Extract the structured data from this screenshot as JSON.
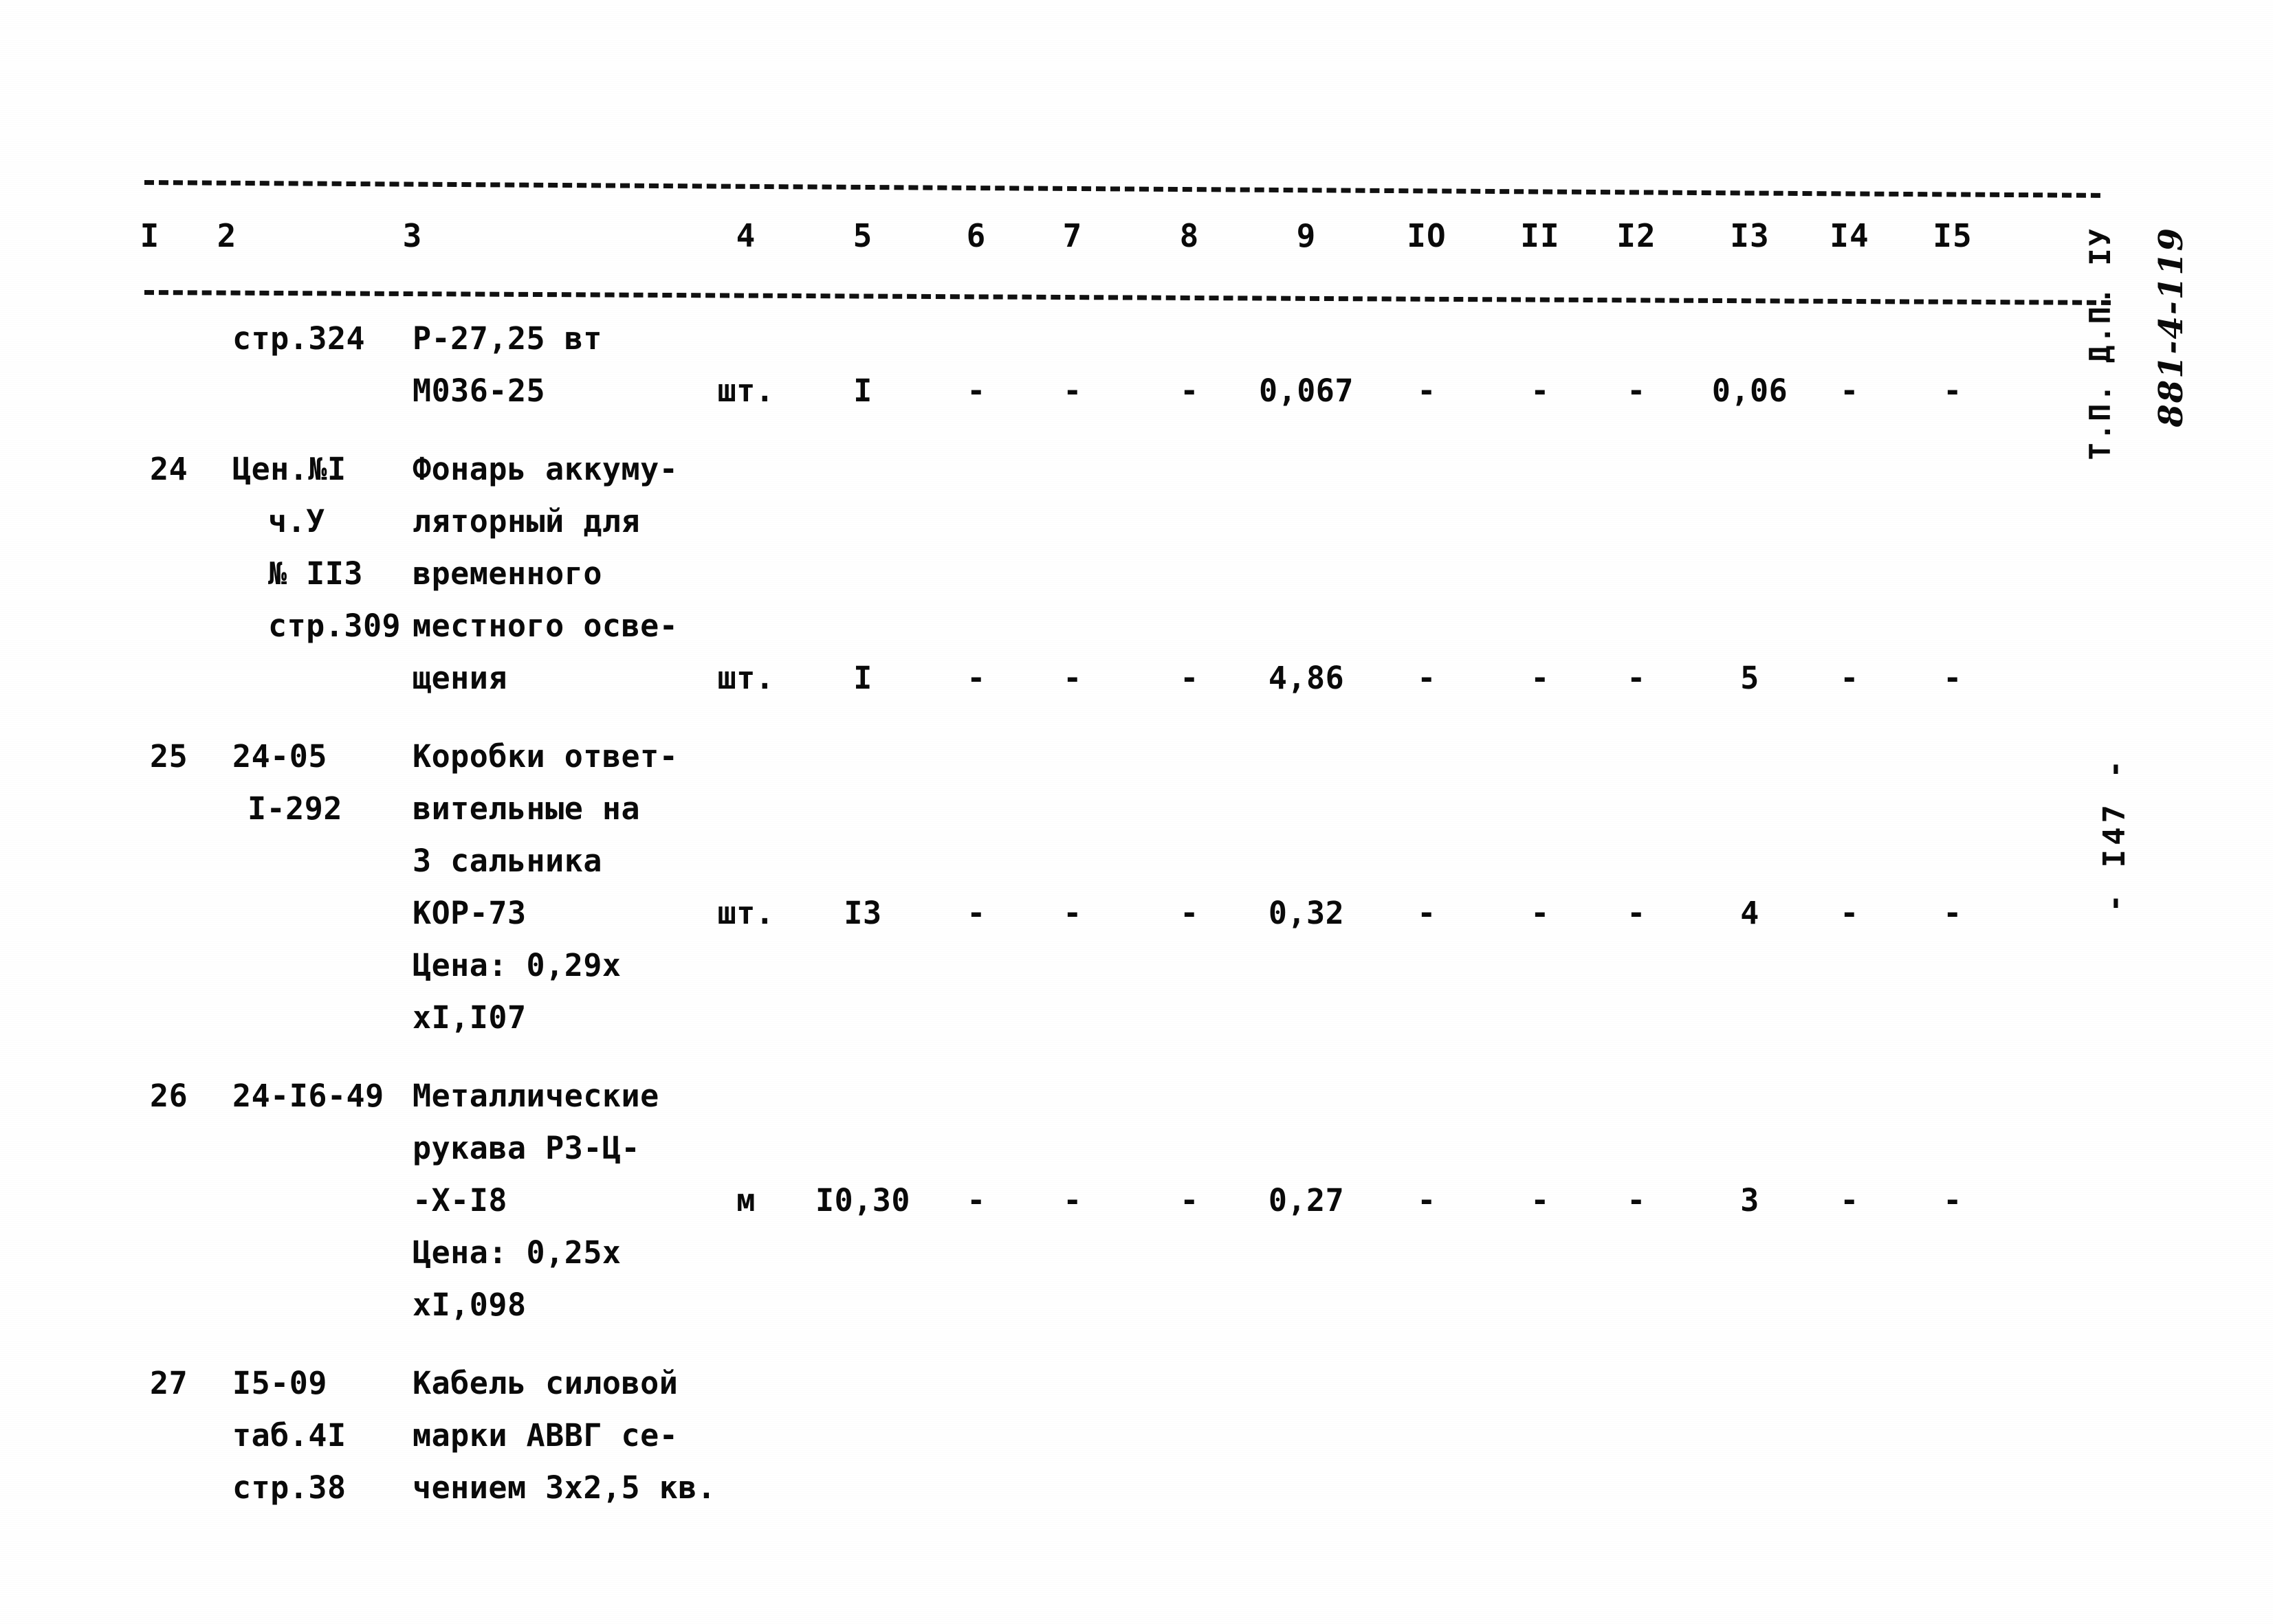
{
  "document": {
    "kind": "scanned-estimate-table",
    "page_number_margin": "- I47 -",
    "margin_stamp_typed": "Т.П. Д.П. IУ",
    "margin_stamp_handwritten": "881-4-119"
  },
  "table": {
    "column_headers": [
      "I",
      "2",
      "3",
      "4",
      "5",
      "6",
      "7",
      "8",
      "9",
      "IO",
      "II",
      "I2",
      "I3",
      "I4",
      "I5"
    ],
    "column_x": [
      218,
      330,
      600,
      1085,
      1255,
      1420,
      1560,
      1730,
      1900,
      2075,
      2240,
      2380,
      2545,
      2690,
      2840
    ],
    "rows": [
      {
        "id": "row-continued",
        "num": "",
        "code_lines": [
          "стр.324"
        ],
        "desc_lines": [
          "Р-27,25 вт",
          "М036-25"
        ],
        "value_line_index": 1,
        "values": {
          "unit": "шт.",
          "c5": "I",
          "c6": "-",
          "c7": "-",
          "c8": "-",
          "c9": "0,067",
          "c10": "-",
          "c11": "-",
          "c12": "-",
          "c13": "0,06",
          "c14": "-",
          "c15": "-"
        }
      },
      {
        "id": "row-24",
        "num": "24",
        "code_lines": [
          "Цен.№I",
          "ч.У",
          "№ IIЗ",
          "стр.309"
        ],
        "desc_lines": [
          "Фонарь аккуму-",
          "ляторный для",
          "временного",
          "местного осве-",
          "щения"
        ],
        "value_line_index": 4,
        "values": {
          "unit": "шт.",
          "c5": "I",
          "c6": "-",
          "c7": "-",
          "c8": "-",
          "c9": "4,86",
          "c10": "-",
          "c11": "-",
          "c12": "-",
          "c13": "5",
          "c14": "-",
          "c15": "-"
        }
      },
      {
        "id": "row-25",
        "num": "25",
        "code_lines": [
          "24-05",
          "I-292"
        ],
        "desc_lines": [
          "Коробки ответ-",
          "вительные на",
          "3 сальника",
          "КОР-73",
          "Цена: 0,29х",
          "хI,I07"
        ],
        "value_line_index": 3,
        "values": {
          "unit": "шт.",
          "c5": "IЗ",
          "c6": "-",
          "c7": "-",
          "c8": "-",
          "c9": "0,32",
          "c10": "-",
          "c11": "-",
          "c12": "-",
          "c13": "4",
          "c14": "-",
          "c15": "-"
        }
      },
      {
        "id": "row-26",
        "num": "26",
        "code_lines": [
          "24-I6-49"
        ],
        "desc_lines": [
          "Металлические",
          "рукава РЗ-Ц-",
          "-Х-I8",
          "Цена: 0,25х",
          "хI,098"
        ],
        "value_line_index": 2,
        "values": {
          "unit": "м",
          "c5": "I0,30",
          "c6": "-",
          "c7": "-",
          "c8": "-",
          "c9": "0,27",
          "c10": "-",
          "c11": "-",
          "c12": "-",
          "c13": "3",
          "c14": "-",
          "c15": "-"
        }
      },
      {
        "id": "row-27",
        "num": "27",
        "code_lines": [
          "I5-09",
          "таб.4I",
          "стр.38"
        ],
        "desc_lines": [
          "Кабель силовой",
          "марки АВВГ се-",
          "чением 3х2,5 кв."
        ],
        "value_line_index": -1,
        "values": {}
      }
    ]
  }
}
